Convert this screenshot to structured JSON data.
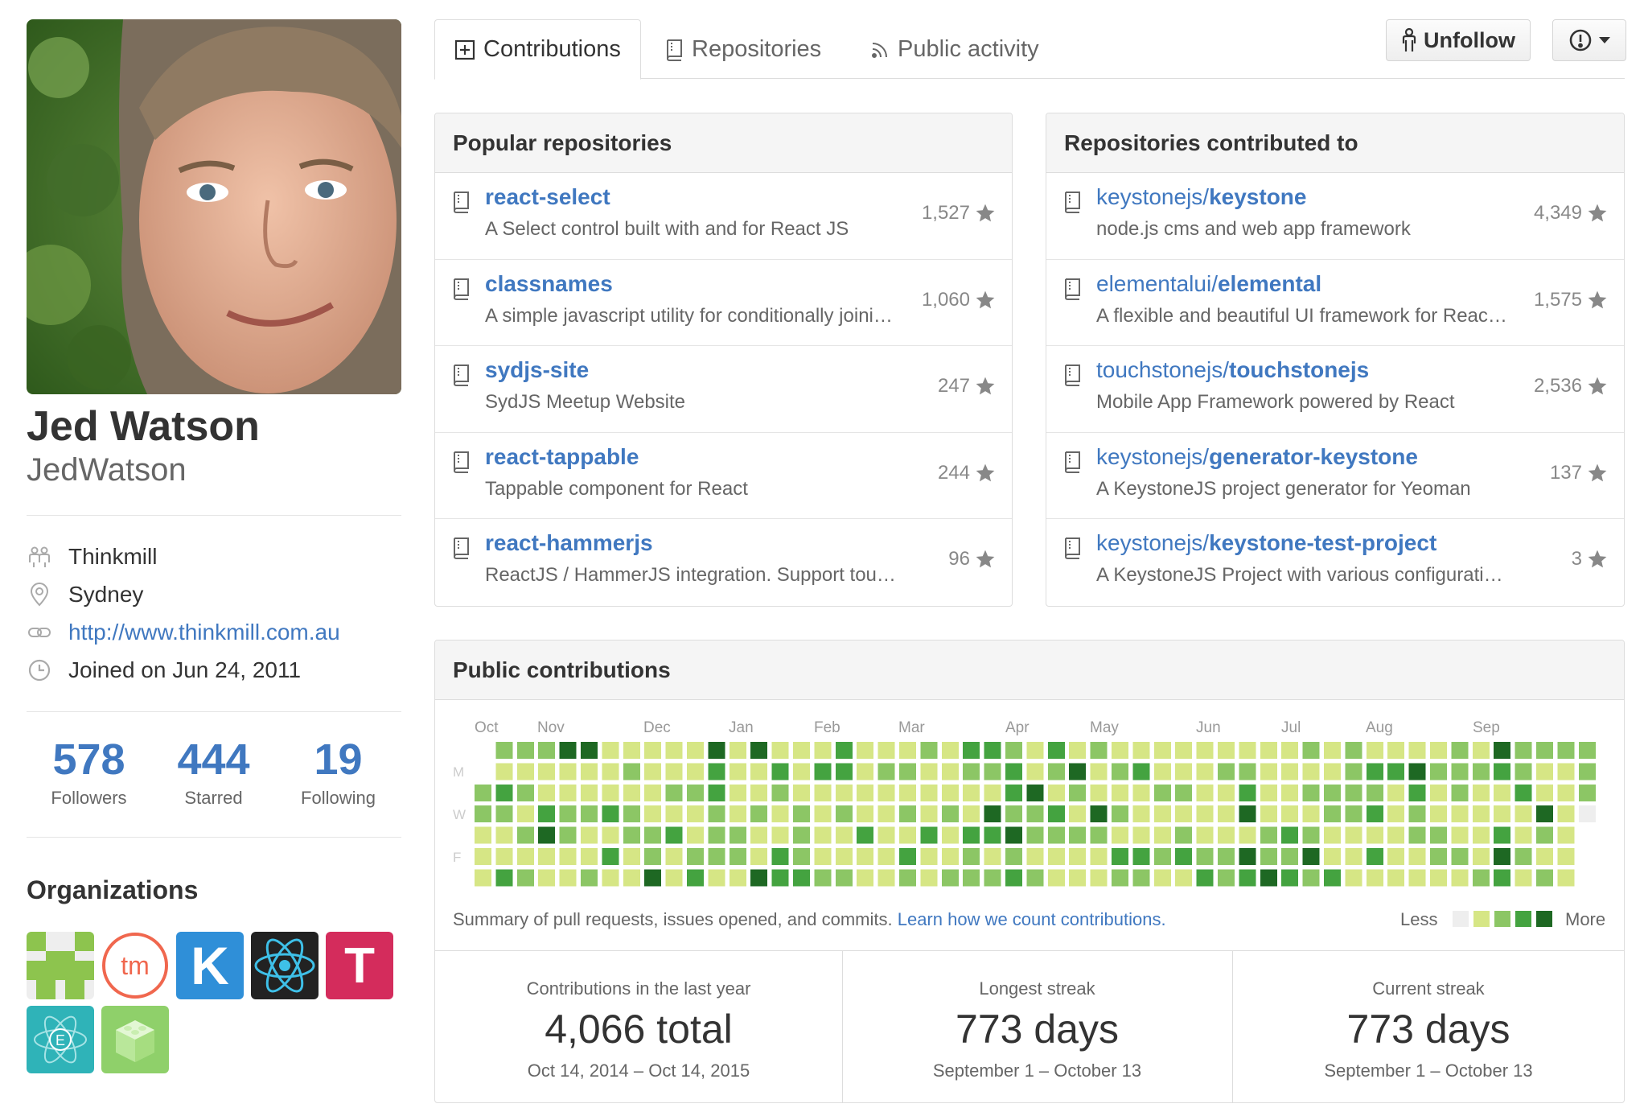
{
  "profile": {
    "fullname": "Jed Watson",
    "username": "JedWatson",
    "company": "Thinkmill",
    "location": "Sydney",
    "website": "http://www.thinkmill.com.au",
    "joined": "Joined on Jun 24, 2011"
  },
  "stats": [
    {
      "value": "578",
      "label": "Followers"
    },
    {
      "value": "444",
      "label": "Starred"
    },
    {
      "value": "19",
      "label": "Following"
    }
  ],
  "organizations": {
    "heading": "Organizations",
    "items": [
      {
        "name": "invader-org",
        "text": ""
      },
      {
        "name": "thinkmill-org",
        "text": "tm"
      },
      {
        "name": "keystonejs-org",
        "text": "K"
      },
      {
        "name": "reactjs-org",
        "text": ""
      },
      {
        "name": "touchstonejs-org",
        "text": "T"
      },
      {
        "name": "elemental-org",
        "text": "E"
      },
      {
        "name": "brick-org",
        "text": ""
      }
    ]
  },
  "tabs": [
    {
      "label": "Contributions",
      "icon": "contributions-icon",
      "active": true
    },
    {
      "label": "Repositories",
      "icon": "repo-icon",
      "active": false
    },
    {
      "label": "Public activity",
      "icon": "rss-icon",
      "active": false
    }
  ],
  "actions": {
    "unfollow_label": "Unfollow"
  },
  "popular": {
    "heading": "Popular repositories",
    "repos": [
      {
        "name": "react-select",
        "desc": "A Select control built with and for React JS",
        "stars": "1,527"
      },
      {
        "name": "classnames",
        "desc": "A simple javascript utility for conditionally joini…",
        "stars": "1,060"
      },
      {
        "name": "sydjs-site",
        "desc": "SydJS Meetup Website",
        "stars": "247"
      },
      {
        "name": "react-tappable",
        "desc": "Tappable component for React",
        "stars": "244"
      },
      {
        "name": "react-hammerjs",
        "desc": "ReactJS / HammerJS integration. Support tou…",
        "stars": "96"
      }
    ]
  },
  "contributed": {
    "heading": "Repositories contributed to",
    "repos": [
      {
        "owner": "keystonejs/",
        "name": "keystone",
        "desc": "node.js cms and web app framework",
        "stars": "4,349"
      },
      {
        "owner": "elementalui/",
        "name": "elemental",
        "desc": "A flexible and beautiful UI framework for Reac…",
        "stars": "1,575"
      },
      {
        "owner": "touchstonejs/",
        "name": "touchstonejs",
        "desc": "Mobile App Framework powered by React",
        "stars": "2,536"
      },
      {
        "owner": "keystonejs/",
        "name": "generator-keystone",
        "desc": "A KeystoneJS project generator for Yeoman",
        "stars": "137"
      },
      {
        "owner": "keystonejs/",
        "name": "keystone-test-project",
        "desc": "A KeystoneJS Project with various configurati…",
        "stars": "3"
      }
    ]
  },
  "contributions": {
    "heading": "Public contributions",
    "months": [
      "Oct",
      "Nov",
      "Dec",
      "Jan",
      "Feb",
      "Mar",
      "Apr",
      "May",
      "Jun",
      "Jul",
      "Aug",
      "Sep"
    ],
    "day_labels": [
      "M",
      "W",
      "F"
    ],
    "summary_text": "Summary of pull requests, issues opened, and commits.",
    "summary_link": "Learn how we count contributions.",
    "legend_less": "Less",
    "legend_more": "More",
    "colors": [
      "#eeeeee",
      "#d6e685",
      "#8cc665",
      "#44a340",
      "#1e6823"
    ],
    "total": {
      "title": "Contributions in the last year",
      "value": "4,066 total",
      "range": "Oct 14, 2014 – Oct 14, 2015"
    },
    "longest": {
      "title": "Longest streak",
      "value": "773 days",
      "range": "September 1 – October 13"
    },
    "current": {
      "title": "Current streak",
      "value": "773 days",
      "range": "September 1 – October 13"
    }
  }
}
